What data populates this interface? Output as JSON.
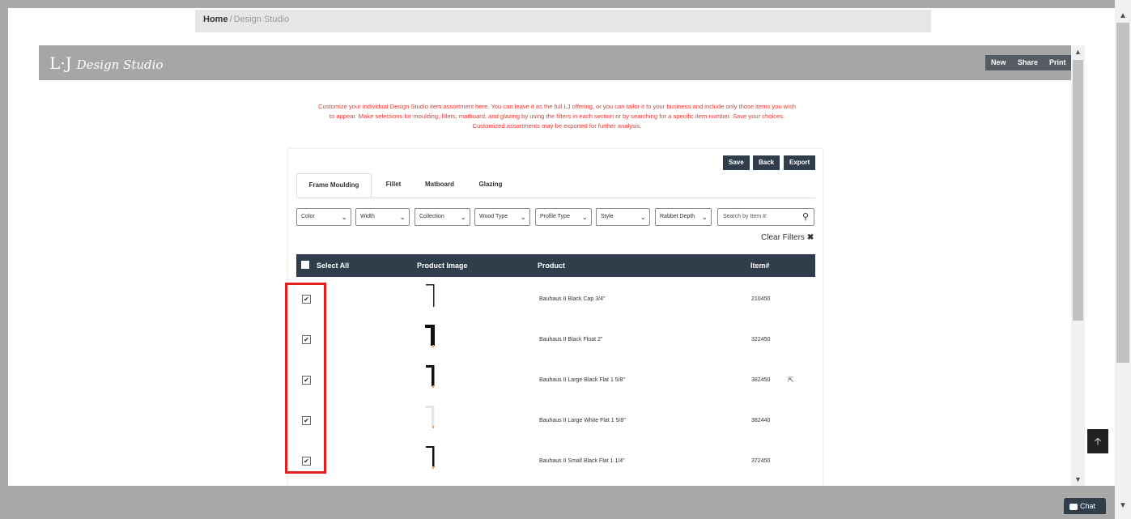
{
  "breadcrumb": {
    "home": "Home",
    "separator": "/",
    "current": "Design Studio"
  },
  "app": {
    "logo_mark": "L·J",
    "logo_text": "Design Studio",
    "header_buttons": {
      "new": "New",
      "share": "Share",
      "print": "Print"
    }
  },
  "intro": {
    "line1": "Customize your individual Design Studio item assortment here. You can leave it as the full LJ offering, or you can tailor it to your business and include only those items you wish",
    "line2": "to appear. Make selections for moulding, fillets, matboard, and glazing by using the filters in each section or by searching for a specific item number. Save your choices.",
    "line3": "Customized assortments may be exported for further analysis."
  },
  "actions": {
    "save": "Save",
    "back": "Back",
    "export": "Export"
  },
  "tabs": [
    "Frame Moulding",
    "Fillet",
    "Matboard",
    "Glazing"
  ],
  "active_tab": "Frame Moulding",
  "filters": [
    "Color",
    "Width",
    "Collection",
    "Wood Type",
    "Profile Type",
    "Style",
    "Rabbet Depth"
  ],
  "search": {
    "placeholder": "Search by Item #:"
  },
  "clear_filters": "Clear Filters",
  "table": {
    "headers": {
      "select_all": "Select All",
      "image": "Product Image",
      "product": "Product",
      "item": "Item#"
    },
    "rows": [
      {
        "product": "Bauhaus II Black Cap 3/4\"",
        "item": "210450",
        "checked": true,
        "profile": "thin-black"
      },
      {
        "product": "Bauhaus II Black Float 2\"",
        "item": "322450",
        "checked": true,
        "profile": "thick-black"
      },
      {
        "product": "Bauhaus II Large Black Flat 1 5/8\"",
        "item": "382450",
        "checked": true,
        "profile": "medium-black"
      },
      {
        "product": "Bauhaus II Large White Flat 1 5/8\"",
        "item": "382440",
        "checked": true,
        "profile": "white"
      },
      {
        "product": "Bauhaus II Small Black Flat 1 1/4\"",
        "item": "372450",
        "checked": true,
        "profile": "small-black"
      }
    ]
  },
  "chat_label": "Chat",
  "checkmark": "✔",
  "colors": {
    "header_dark": "#2f3e4a",
    "intro_red": "#e53935",
    "highlight_red": "#e02020",
    "app_header": "#a6a6a6"
  }
}
